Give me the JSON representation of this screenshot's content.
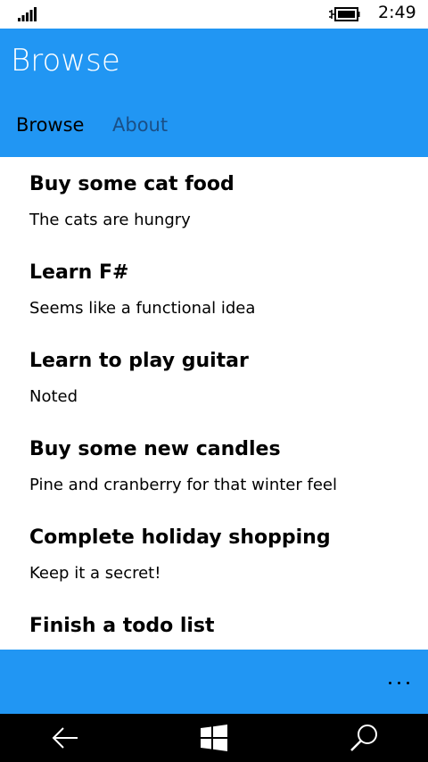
{
  "status_bar": {
    "time": "2:49",
    "signal_icon": "signal-bars-icon",
    "battery_icon": "battery-charging-icon"
  },
  "header": {
    "title": "Browse",
    "tabs": [
      {
        "label": "Browse",
        "selected": true
      },
      {
        "label": "About",
        "selected": false
      }
    ]
  },
  "items": [
    {
      "title": "Buy some cat food",
      "description": "The cats are hungry"
    },
    {
      "title": "Learn F#",
      "description": "Seems like a functional idea"
    },
    {
      "title": "Learn to play guitar",
      "description": "Noted"
    },
    {
      "title": "Buy some new candles",
      "description": "Pine and cranberry for that winter feel"
    },
    {
      "title": "Complete holiday shopping",
      "description": "Keep it a secret!"
    },
    {
      "title": "Finish a todo list",
      "description": ""
    }
  ],
  "app_bar": {
    "more_icon": "ellipsis-icon"
  },
  "nav_bar": {
    "back_icon": "back-arrow-icon",
    "start_icon": "windows-logo-icon",
    "search_icon": "search-icon"
  },
  "colors": {
    "accent": "#2196f3",
    "tab_inactive": "#1a4f86",
    "nav_background": "#000000"
  }
}
